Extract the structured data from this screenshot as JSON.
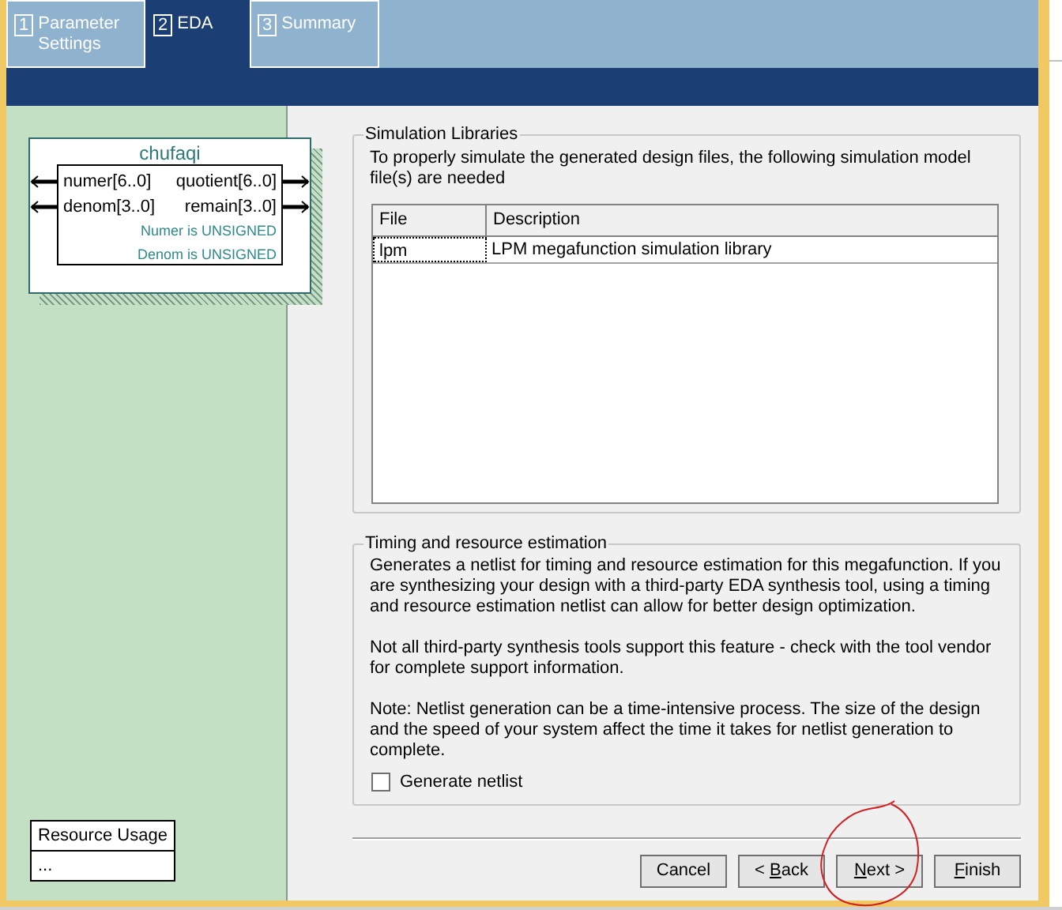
{
  "tabs": [
    {
      "number": "1",
      "label": "Parameter Settings",
      "selected": false
    },
    {
      "number": "2",
      "label": "EDA",
      "selected": true
    },
    {
      "number": "3",
      "label": "Summary",
      "selected": false
    }
  ],
  "symbol": {
    "title": "chufaqi",
    "inputs": [
      "numer[6..0]",
      "denom[3..0]"
    ],
    "outputs": [
      "quotient[6..0]",
      "remain[3..0]"
    ],
    "notes": [
      "Numer is UNSIGNED",
      "Denom is UNSIGNED"
    ]
  },
  "resource_usage": {
    "title": "Resource Usage",
    "value": "..."
  },
  "simulation_libraries": {
    "title": "Simulation Libraries",
    "description": "To properly simulate the generated design files, the following simulation model file(s) are needed",
    "columns": [
      "File",
      "Description"
    ],
    "rows": [
      [
        "lpm",
        "LPM megafunction simulation library"
      ]
    ]
  },
  "timing": {
    "title": "Timing and resource estimation",
    "paragraphs": [
      "Generates a netlist for timing and resource estimation for this megafunction. If you are synthesizing your design with a third-party EDA synthesis tool, using a timing and resource estimation netlist can allow for better design optimization.",
      "Not all third-party synthesis tools support this feature - check with the tool vendor for complete support information.",
      "Note: Netlist generation can be a time-intensive process. The size of the design and the speed of your system affect the time it takes for netlist generation to complete."
    ],
    "checkbox": {
      "label": "Generate netlist",
      "checked": false
    }
  },
  "buttons": [
    {
      "after": "Cancel"
    },
    {
      "before": "< ",
      "key": "B",
      "after": "ack"
    },
    {
      "key": "N",
      "after": "ext >"
    },
    {
      "key": "F",
      "after": "inish"
    }
  ],
  "annotation": {
    "kind": "circle"
  }
}
